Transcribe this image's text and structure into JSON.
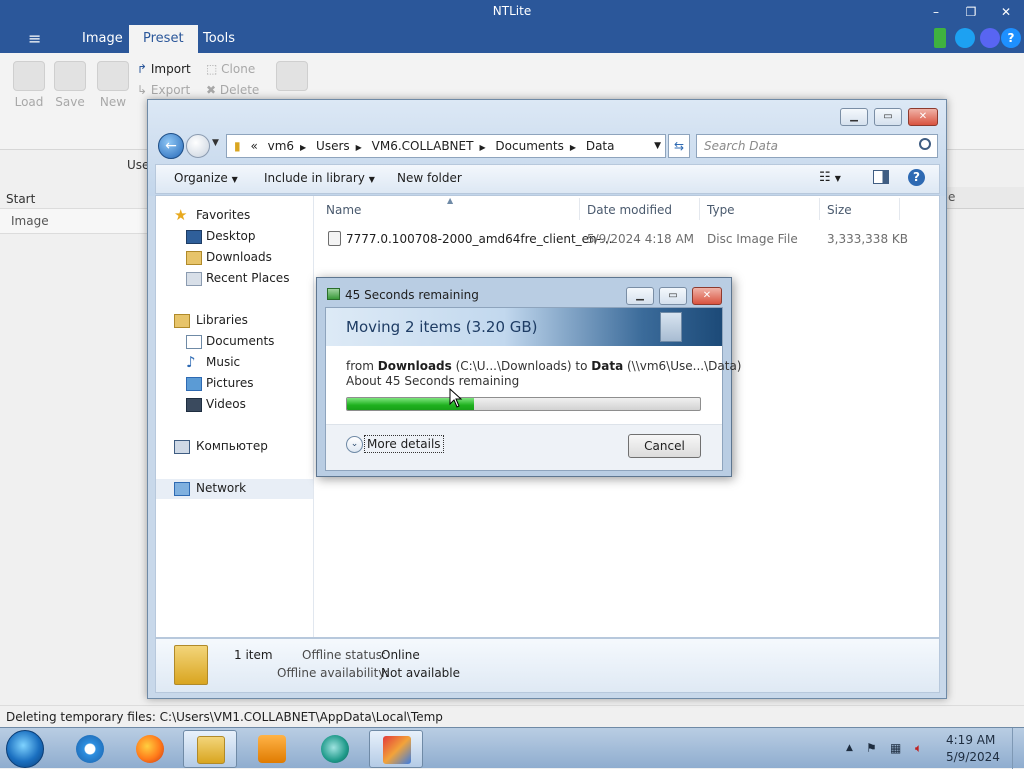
{
  "ntlite": {
    "title": "NTLite",
    "menu_icon": "hamburger-icon",
    "tabs": [
      {
        "label": "Image",
        "active": false
      },
      {
        "label": "Preset",
        "active": true
      },
      {
        "label": "Tools",
        "active": false
      }
    ],
    "ribbon": {
      "load": "Load",
      "save": "Save",
      "new": "New",
      "import": "Import",
      "export": "Export",
      "clone": "Clone",
      "delete": "Delete"
    },
    "left_panel": {
      "user_label": "Use",
      "start_label": "Start",
      "image_label": "Image"
    },
    "right_panel_fragment": "e",
    "status_text": "Deleting temporary files: C:\\Users\\VM1.COLLABNET\\AppData\\Local\\Temp",
    "accent_color": "#2b579a"
  },
  "explorer": {
    "address": {
      "overflow": "«",
      "segments": [
        "vm6",
        "Users",
        "VM6.COLLABNET",
        "Documents",
        "Data"
      ]
    },
    "search_placeholder": "Search Data",
    "commands": {
      "organize": "Organize",
      "include": "Include in library",
      "new_folder": "New folder"
    },
    "nav": {
      "favorites": "Favorites",
      "desktop": "Desktop",
      "downloads": "Downloads",
      "recent": "Recent Places",
      "libraries": "Libraries",
      "documents": "Documents",
      "music": "Music",
      "pictures": "Pictures",
      "videos": "Videos",
      "computer": "Компьютер",
      "network": "Network"
    },
    "columns": {
      "name": "Name",
      "date": "Date modified",
      "type": "Type",
      "size": "Size"
    },
    "files": [
      {
        "name": "7777.0.100708-2000_amd64fre_client_en-...",
        "date": "5/9/2024 4:18 AM",
        "type": "Disc Image File",
        "size": "3,333,338 KB"
      }
    ],
    "details": {
      "count": "1 item",
      "offline_status_label": "Offline status:",
      "offline_status": "Online",
      "offline_avail_label": "Offline availability:",
      "offline_avail": "Not available"
    }
  },
  "copy_dialog": {
    "title": "45 Seconds remaining",
    "heading": "Moving 2 items (3.20 GB)",
    "from_prefix": "from ",
    "from_name": "Downloads",
    "from_path": " (C:\\U...\\Downloads) to ",
    "to_name": "Data",
    "to_path": " (\\\\vm6\\Use...\\Data)",
    "remaining": "About 45 Seconds remaining",
    "progress": 0.36,
    "more_details": "More details",
    "cancel": "Cancel"
  },
  "taskbar": {
    "programs": [
      "internet-explorer-icon",
      "firefox-icon",
      "file-explorer-icon",
      "media-player-icon",
      "browser-icon",
      "ntlite-icon"
    ],
    "time": "4:19 AM",
    "date": "5/9/2024"
  }
}
